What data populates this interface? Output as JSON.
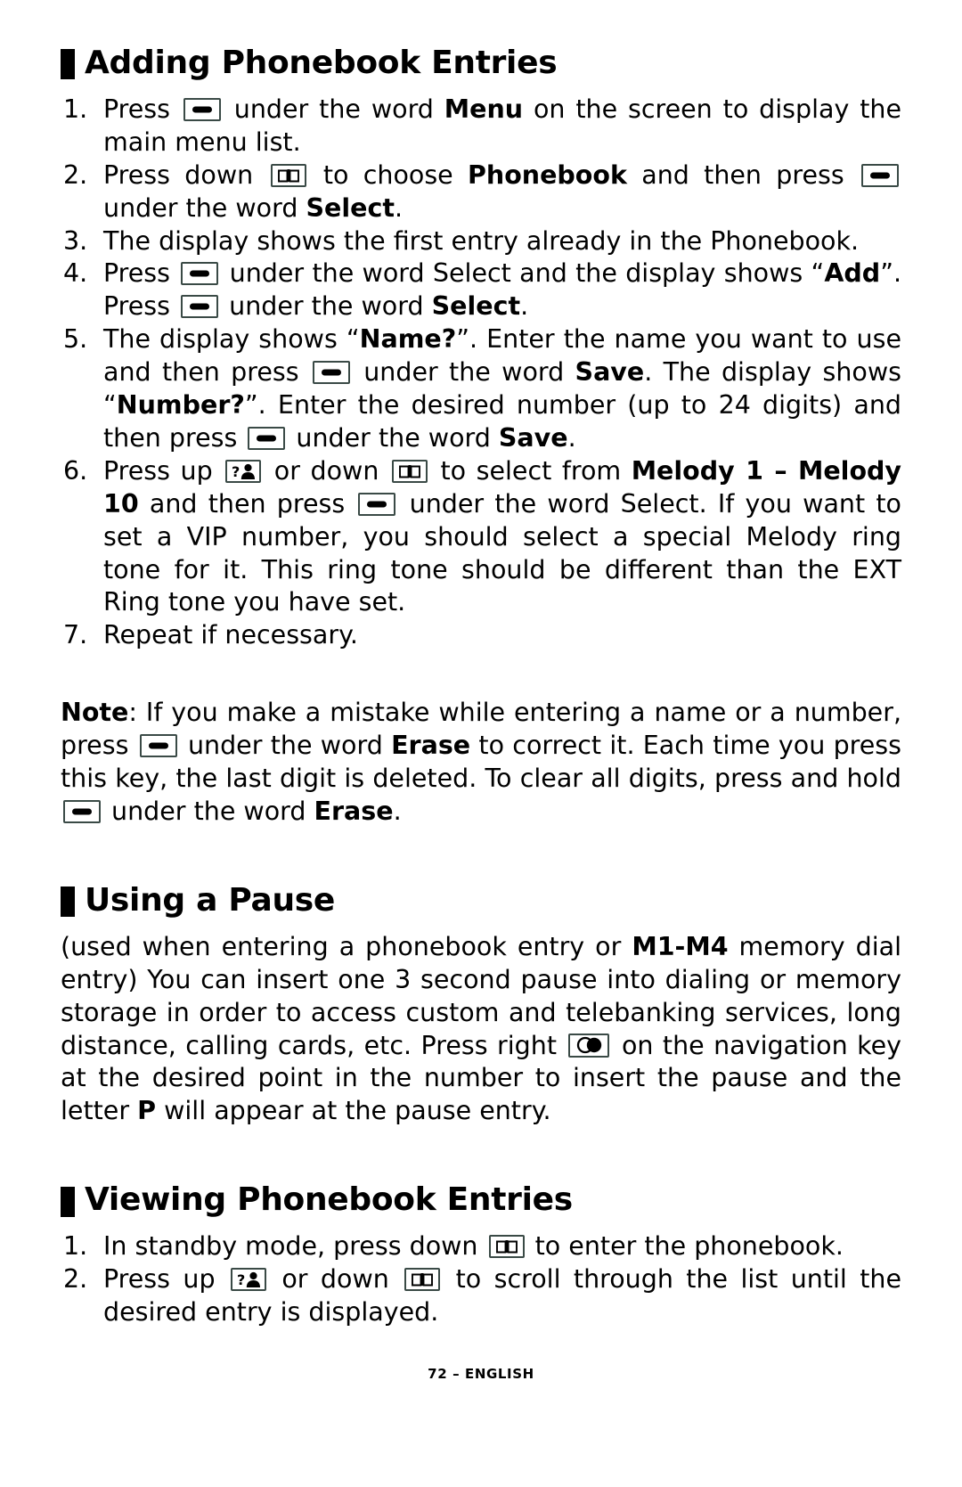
{
  "page": {
    "footer": "72 – ENGLISH",
    "accent_color": "#000000",
    "key_border_color": "#3a4a46"
  },
  "sections": [
    {
      "id": "adding-phonebook-entries",
      "heading": "Adding Phonebook Entries",
      "steps": [
        {
          "num": "1.",
          "parts": [
            {
              "t": "text",
              "v": "Press "
            },
            {
              "t": "icon",
              "v": "softkey-icon"
            },
            {
              "t": "text",
              "v": " under the word "
            },
            {
              "t": "bold",
              "v": "Menu"
            },
            {
              "t": "text",
              "v": " on the screen to display the main menu list."
            }
          ]
        },
        {
          "num": "2.",
          "parts": [
            {
              "t": "text",
              "v": "Press down "
            },
            {
              "t": "icon",
              "v": "phonebook-down-key-icon"
            },
            {
              "t": "text",
              "v": " to choose "
            },
            {
              "t": "bold",
              "v": "Phonebook"
            },
            {
              "t": "text",
              "v": " and then press "
            },
            {
              "t": "icon",
              "v": "softkey-icon"
            },
            {
              "t": "text",
              "v": " under the word "
            },
            {
              "t": "bold",
              "v": "Select"
            },
            {
              "t": "text",
              "v": "."
            }
          ]
        },
        {
          "num": "3.",
          "parts": [
            {
              "t": "text",
              "v": "The display shows the first entry already in the Phonebook."
            }
          ]
        },
        {
          "num": "4.",
          "parts": [
            {
              "t": "text",
              "v": "Press "
            },
            {
              "t": "icon",
              "v": "softkey-icon"
            },
            {
              "t": "text",
              "v": " under the word Select and the display shows “"
            },
            {
              "t": "bold",
              "v": "Add"
            },
            {
              "t": "text",
              "v": "”.  Press "
            },
            {
              "t": "icon",
              "v": "softkey-icon"
            },
            {
              "t": "text",
              "v": " under the word "
            },
            {
              "t": "bold",
              "v": "Select"
            },
            {
              "t": "text",
              "v": "."
            }
          ]
        },
        {
          "num": "5.",
          "parts": [
            {
              "t": "text",
              "v": "The display shows “"
            },
            {
              "t": "bold",
              "v": "Name?"
            },
            {
              "t": "text",
              "v": "”. Enter the name you want to use and then press "
            },
            {
              "t": "icon",
              "v": "softkey-icon"
            },
            {
              "t": "text",
              "v": " under the word "
            },
            {
              "t": "bold",
              "v": "Save"
            },
            {
              "t": "text",
              "v": ". The display shows “"
            },
            {
              "t": "bold",
              "v": "Number?"
            },
            {
              "t": "text",
              "v": "”. Enter the desired number (up to 24 digits) and then press "
            },
            {
              "t": "icon",
              "v": "softkey-icon"
            },
            {
              "t": "text",
              "v": " under the word "
            },
            {
              "t": "bold",
              "v": "Save"
            },
            {
              "t": "text",
              "v": "."
            }
          ]
        },
        {
          "num": "6.",
          "parts": [
            {
              "t": "text",
              "v": "Press up "
            },
            {
              "t": "icon",
              "v": "caller-id-up-key-icon"
            },
            {
              "t": "text",
              "v": " or down "
            },
            {
              "t": "icon",
              "v": "phonebook-down-key-icon"
            },
            {
              "t": "text",
              "v": " to select from "
            },
            {
              "t": "bold",
              "v": "Melody 1 – Melody 10"
            },
            {
              "t": "text",
              "v": " and then press "
            },
            {
              "t": "icon",
              "v": "softkey-icon"
            },
            {
              "t": "text",
              "v": " under the word Select.  If you want to set a VIP number, you should select a special Melody ring tone for it.  This ring tone should be different than the EXT Ring tone you have set."
            }
          ]
        },
        {
          "num": "7.",
          "parts": [
            {
              "t": "text",
              "v": "Repeat if necessary."
            }
          ]
        }
      ],
      "note": {
        "parts": [
          {
            "t": "bold",
            "v": "Note"
          },
          {
            "t": "text",
            "v": ": If you make a mistake while entering a name or a number, press "
          },
          {
            "t": "icon",
            "v": "softkey-icon"
          },
          {
            "t": "text",
            "v": " under the word "
          },
          {
            "t": "bold",
            "v": "Erase"
          },
          {
            "t": "text",
            "v": " to correct it. Each time you press this key, the last digit is deleted. To clear all digits, press and hold "
          },
          {
            "t": "icon",
            "v": "softkey-icon"
          },
          {
            "t": "text",
            "v": " under the word "
          },
          {
            "t": "bold",
            "v": "Erase"
          },
          {
            "t": "text",
            "v": "."
          }
        ]
      }
    },
    {
      "id": "using-a-pause",
      "heading": "Using a Pause",
      "paragraph": {
        "parts": [
          {
            "t": "text",
            "v": "(used when entering a phonebook entry or "
          },
          {
            "t": "bold",
            "v": "M1-M4"
          },
          {
            "t": "text",
            "v": " memory dial entry) You can insert one 3 second pause into dialing or memory storage in order to access custom and telebanking services, long distance, calling cards, etc.  Press right "
          },
          {
            "t": "icon",
            "v": "navigation-key-icon"
          },
          {
            "t": "text",
            "v": " on the navigation key at the desired point in the number to insert the pause and the letter "
          },
          {
            "t": "bold",
            "v": "P"
          },
          {
            "t": "text",
            "v": " will appear at the pause entry."
          }
        ]
      }
    },
    {
      "id": "viewing-phonebook-entries",
      "heading": "Viewing Phonebook Entries",
      "steps": [
        {
          "num": "1.",
          "parts": [
            {
              "t": "text",
              "v": "In standby mode, press down "
            },
            {
              "t": "icon",
              "v": "phonebook-down-key-icon"
            },
            {
              "t": "text",
              "v": " to enter the phonebook."
            }
          ]
        },
        {
          "num": "2.",
          "parts": [
            {
              "t": "text",
              "v": "Press up "
            },
            {
              "t": "icon",
              "v": "caller-id-up-key-icon"
            },
            {
              "t": "text",
              "v": " or down "
            },
            {
              "t": "icon",
              "v": "phonebook-down-key-icon"
            },
            {
              "t": "text",
              "v": " to scroll through the list until the desired entry is displayed."
            }
          ]
        }
      ]
    }
  ]
}
